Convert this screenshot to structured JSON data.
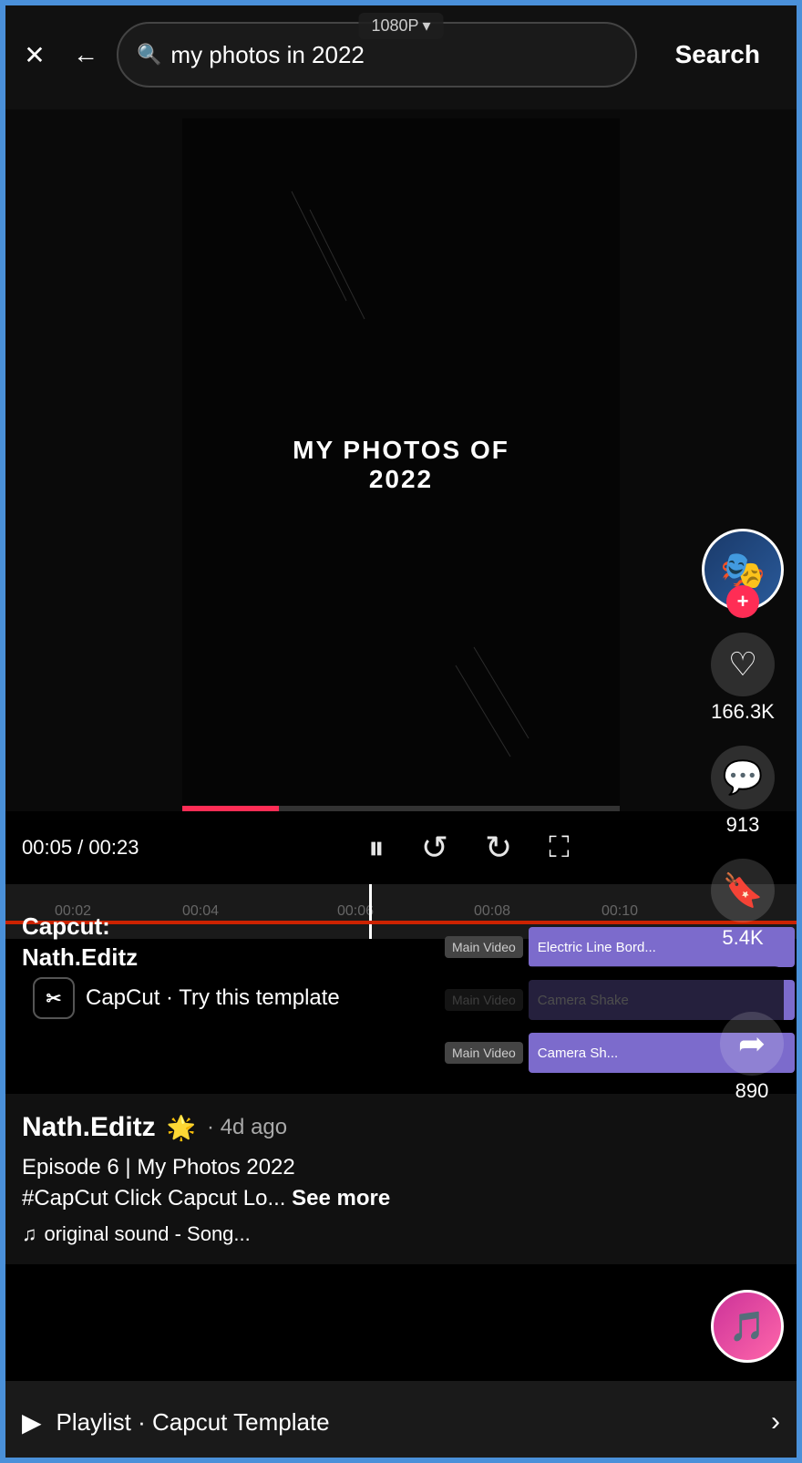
{
  "header": {
    "close_label": "✕",
    "back_label": "←",
    "search_placeholder": "my photos in 2022",
    "search_query": "my photos in 2022",
    "search_button_label": "Search",
    "resolution": "1080P",
    "resolution_arrow": "▾"
  },
  "video": {
    "title": "MY PHOTOS OF 2022",
    "progress_current": "00:05",
    "progress_total": "00:23",
    "timeline_ticks": [
      "00:02",
      "00:04",
      "00:06",
      "00:08",
      "00:10"
    ]
  },
  "actions": {
    "avatar_icon": "🎭",
    "plus_icon": "+",
    "like_icon": "♡",
    "like_count": "166.3K",
    "comment_icon": "💬",
    "comment_count": "913",
    "bookmark_icon": "🔖",
    "bookmark_count": "5.4K",
    "share_icon": "➦",
    "share_count": "890"
  },
  "capcut": {
    "logo_text": "⊗",
    "try_label": "CapCut · Try this template"
  },
  "editor": {
    "watermark_text": "Capcut:\nNath.Editz",
    "tracks": [
      {
        "label": "Main Video",
        "content": "Electric Line Bord..."
      },
      {
        "label": "Main Video",
        "content": "Camera Shake"
      },
      {
        "label": "Main Video",
        "content": "Camera Sh..."
      }
    ]
  },
  "user_info": {
    "username": "Nath.Editz",
    "badge": "🌟",
    "time_ago": "· 4d ago",
    "description": "Episode 6 | My Photos 2022\n#CapCut Click Capcut Lo...",
    "see_more_label": "See more",
    "sound_note": "♫",
    "sound_text": "original sound - Song..."
  },
  "playlist": {
    "icon": "▶",
    "label": "Playlist · Capcut Template",
    "chevron": "›"
  },
  "bottom_avatar": {
    "icon": "🎵"
  },
  "controls": {
    "pause_icon": "⏸",
    "rewind_icon": "↺",
    "forward_icon": "↻",
    "expand_icon": "⛶"
  }
}
